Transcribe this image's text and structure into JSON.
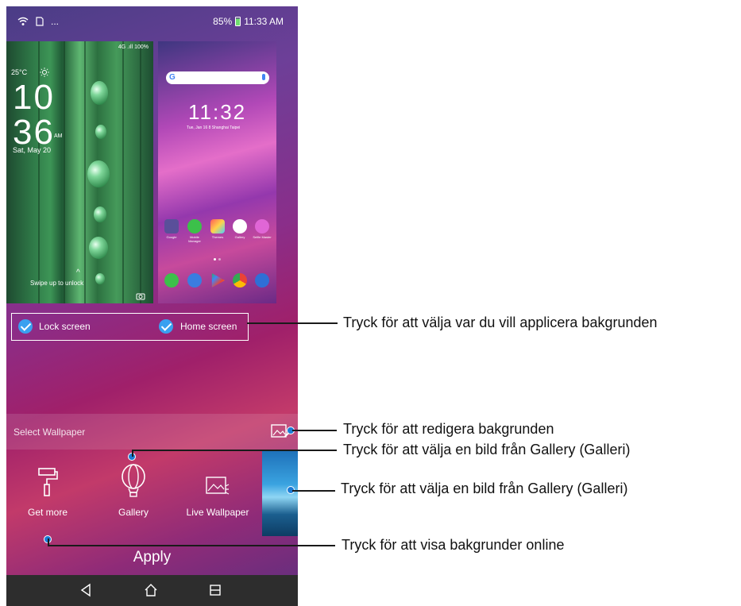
{
  "status_bar": {
    "battery_percent": "85%",
    "time": "11:33 AM",
    "more_indicator": "..."
  },
  "lock_preview": {
    "temperature": "25°C",
    "clock_hour": "10",
    "clock_minute": "36",
    "am_pm": "AM",
    "date": "Sat, May 20",
    "signal_text": "4G .ıll 100%",
    "unlock_hint": "Swipe up to unlock"
  },
  "home_preview": {
    "search_logo": "G",
    "clock": "11:32",
    "date_line": "Tue, Jan 16  8 Shanghai  Taipei",
    "apps_row1": [
      "Google",
      "Mobile Manager",
      "Themes",
      "Gallery",
      "Selfie Master"
    ]
  },
  "apply_to": {
    "lock_screen_label": "Lock screen",
    "home_screen_label": "Home screen",
    "check_color": "#3aa0f0"
  },
  "select_wallpaper_label": "Select Wallpaper",
  "tools": [
    {
      "label": "Get more",
      "icon": "paint-roller-icon"
    },
    {
      "label": "Gallery",
      "icon": "balloon-icon"
    },
    {
      "label": "Live Wallpaper",
      "icon": "live-wallpaper-icon"
    }
  ],
  "apply_label": "Apply",
  "callouts": [
    "Tryck för att välja var du vill applicera bakgrunden",
    "Tryck för att redigera bakgrunden",
    "Tryck för att välja en bild från Gallery (Galleri)",
    "Tryck för att välja en bild från Gallery (Galleri)",
    "Tryck för att visa bakgrunder online"
  ],
  "colors": {
    "callout_dot": "#1a7bd6",
    "nav_bar": "#2d2d2d"
  }
}
